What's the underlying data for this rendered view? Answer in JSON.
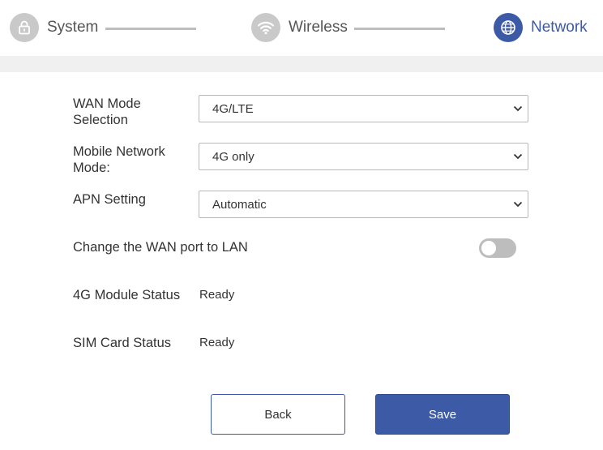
{
  "stepper": {
    "steps": [
      {
        "label": "System",
        "icon": "lock-icon",
        "state": "inactive"
      },
      {
        "label": "Wireless",
        "icon": "wifi-icon",
        "state": "inactive"
      },
      {
        "label": "Network",
        "icon": "globe-icon",
        "state": "active"
      }
    ]
  },
  "form": {
    "wan_mode": {
      "label": "WAN Mode Selection",
      "value": "4G/LTE"
    },
    "mobile_mode": {
      "label": "Mobile Network Mode:",
      "value": "4G only"
    },
    "apn": {
      "label": "APN Setting",
      "value": "Automatic"
    },
    "wan_to_lan": {
      "label": "Change the WAN port to LAN",
      "enabled": false
    },
    "module_status": {
      "label": "4G Module Status",
      "value": "Ready"
    },
    "sim_status": {
      "label": "SIM Card Status",
      "value": "Ready"
    }
  },
  "buttons": {
    "back": "Back",
    "save": "Save"
  },
  "colors": {
    "accent": "#3c5aa6",
    "inactive": "#c9c9c9",
    "band": "#f0f0f0"
  }
}
